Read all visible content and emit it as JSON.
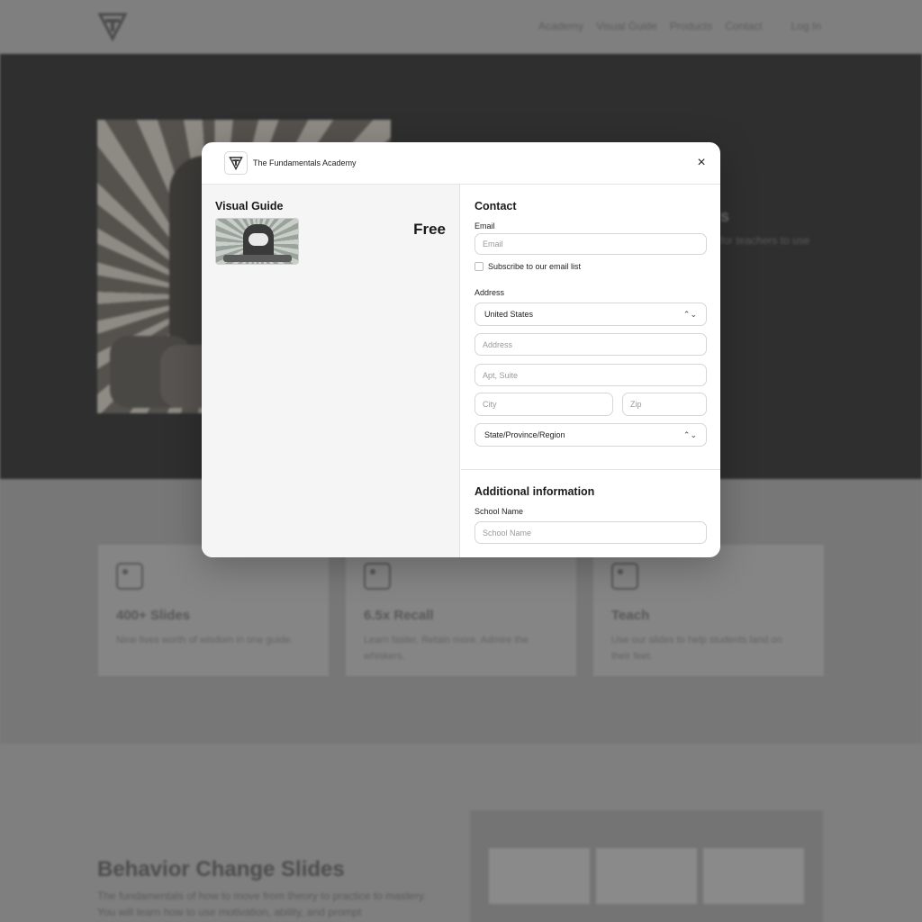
{
  "background": {
    "nav": {
      "links": [
        "Academy",
        "Visual Guide",
        "Products",
        "Contact"
      ],
      "login": "Log In"
    },
    "hero": {
      "side_title": "s",
      "side_text": "for teachers to use"
    },
    "features": [
      {
        "title": "400+ Slides",
        "text": "Nine lives worth of wisdom in one guide.",
        "icon": "image-icon"
      },
      {
        "title": "6.5x Recall",
        "text": "Learn faster. Retain more. Admire the whiskers.",
        "icon": "image-icon"
      },
      {
        "title": "Teach",
        "text": "Use our slides to help students land on their feet.",
        "icon": "image-icon"
      }
    ],
    "slides_section": {
      "title": "Behavior Change Slides",
      "text": "The fundamentals of how to move from theory to practice to mastery. You will learn how to use motivation, ability, and prompt"
    }
  },
  "modal": {
    "brand": "The Fundamentals Academy",
    "close": "×",
    "product": {
      "title": "Visual Guide",
      "price": "Free"
    },
    "contact": {
      "title": "Contact",
      "email_label": "Email",
      "email_placeholder": "Email",
      "subscribe_label": "Subscribe to our email list"
    },
    "address": {
      "label": "Address",
      "country": "United States",
      "address_placeholder": "Address",
      "apt_placeholder": "Apt, Suite",
      "city_placeholder": "City",
      "zip_placeholder": "Zip",
      "state": "State/Province/Region"
    },
    "additional": {
      "title": "Additional information",
      "school_label": "School Name",
      "school_placeholder": "School Name"
    }
  }
}
